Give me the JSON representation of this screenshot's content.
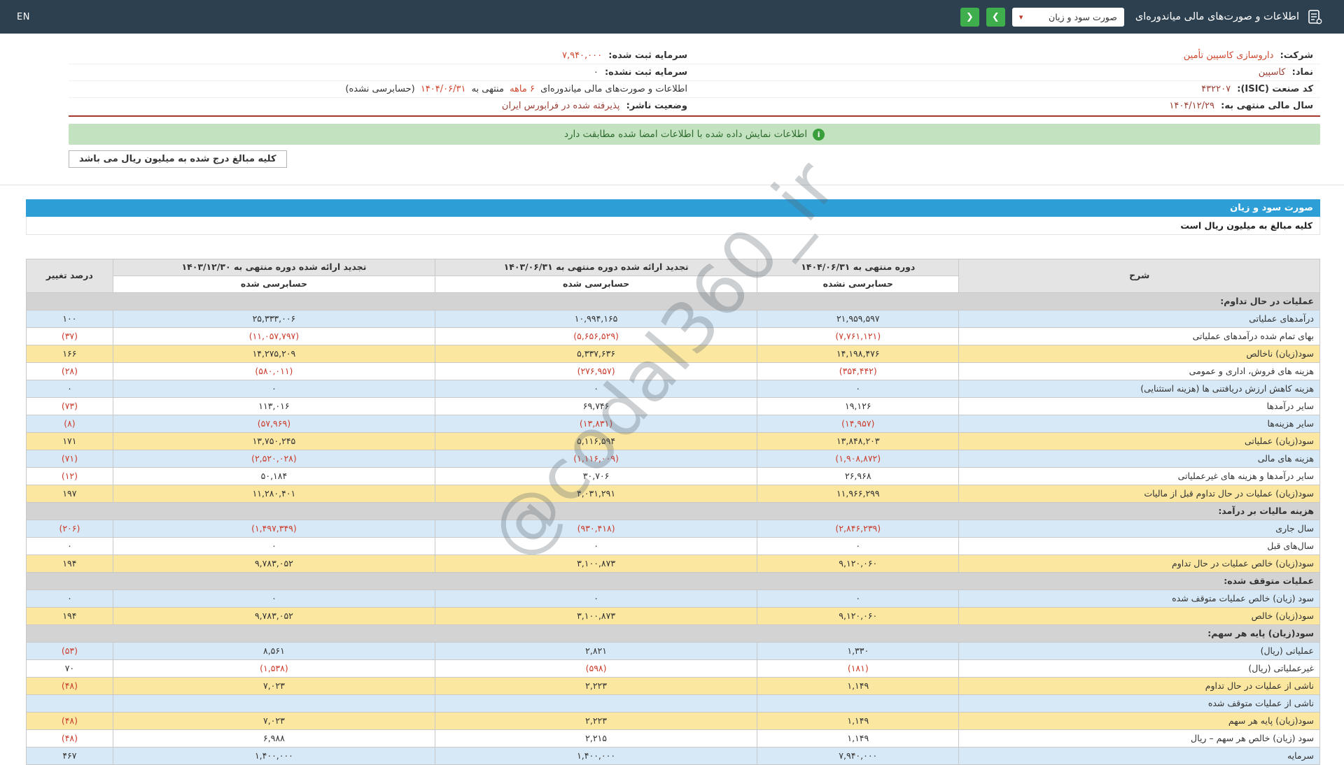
{
  "topbar": {
    "title": "اطلاعات و صورت‌های مالی میاندوره‌ای",
    "dropdown_value": "صورت سود و زیان",
    "dropdown_caret": "▾",
    "nav_forward": "❯",
    "nav_back": "❮",
    "lang": "EN"
  },
  "company_info": {
    "company": {
      "label": "شرکت:",
      "value": "داروسازی کاسپین تأمین"
    },
    "symbol": {
      "label": "نماد:",
      "value": "کاسپین"
    },
    "isic": {
      "label": "کد صنعت (ISIC):",
      "value": "۴۳۲۲۰۷"
    },
    "fiscal_year": {
      "label": "سال مالی منتهی به:",
      "value": "۱۴۰۴/۱۲/۲۹"
    },
    "capital_registered": {
      "label": "سرمایه ثبت شده:",
      "value": "۷,۹۴۰,۰۰۰"
    },
    "capital_unregistered": {
      "label": "سرمایه ثبت نشده:",
      "value": "۰"
    },
    "period_line": {
      "prefix": "اطلاعات و صورت‌های مالی میاندوره‌ای",
      "duration": "۶ ماهه",
      "middle": "منتهی به",
      "date": "۱۴۰۴/۰۶/۳۱",
      "suffix": "(حسابرسی نشده)"
    },
    "issuer_status": {
      "label": "وضعیت ناشر:",
      "value": "پذیرفته شده در فرابورس ایران"
    }
  },
  "notice": {
    "text": "اطلاعات نمایش داده شده با اطلاعات امضا شده مطابقت دارد",
    "icon_glyph": "i"
  },
  "amounts_note": "کلیه مبالغ درج شده به میلیون ریال می باشد",
  "statement": {
    "title": "صورت سود و زیان",
    "unit_note": "کلیه مبالغ به میلیون ریال است",
    "watermark": "@codal360_ir",
    "headers": {
      "desc": "شرح",
      "col1": "دوره منتهی به ۱۴۰۴/۰۶/۳۱",
      "col1_sub": "حسابرسی نشده",
      "col2": "تجدید ارائه شده دوره منتهی به ۱۴۰۳/۰۶/۳۱",
      "col2_sub": "حسابرسی شده",
      "col3": "تجدید ارائه شده دوره منتهی به ۱۴۰۳/۱۲/۳۰",
      "col3_sub": "حسابرسی شده",
      "change": "درصد تغییر"
    },
    "rows": [
      {
        "type": "section",
        "label": "عملیات در حال تداوم:"
      },
      {
        "type": "data",
        "bg": "blue",
        "label": "درآمدهای عملیاتی",
        "values": [
          "۲۱,۹۵۹,۵۹۷",
          "۱۰,۹۹۴,۱۶۵",
          "۲۵,۳۳۳,۰۰۶"
        ],
        "change": "۱۰۰"
      },
      {
        "type": "data",
        "bg": "white",
        "label": "بهای تمام شده درآمدهای عملیاتی",
        "values": [
          "(۷,۷۶۱,۱۲۱)",
          "(۵,۶۵۶,۵۲۹)",
          "(۱۱,۰۵۷,۷۹۷)"
        ],
        "change": "(۳۷)"
      },
      {
        "type": "data",
        "bg": "yellow",
        "label": "سود(زیان) ناخالص",
        "values": [
          "۱۴,۱۹۸,۴۷۶",
          "۵,۳۳۷,۶۳۶",
          "۱۴,۲۷۵,۲۰۹"
        ],
        "change": "۱۶۶"
      },
      {
        "type": "data",
        "bg": "white",
        "label": "هزینه های فروش، اداری و عمومی",
        "values": [
          "(۳۵۴,۴۴۲)",
          "(۲۷۶,۹۵۷)",
          "(۵۸۰,۰۱۱)"
        ],
        "change": "(۲۸)"
      },
      {
        "type": "data",
        "bg": "blue",
        "label": "هزینه کاهش ارزش دریافتنی ها (هزینه استثنایی)",
        "values": [
          "۰",
          "۰",
          "۰"
        ],
        "change": "۰"
      },
      {
        "type": "data",
        "bg": "white",
        "label": "سایر درآمدها",
        "values": [
          "۱۹,۱۲۶",
          "۶۹,۷۴۶",
          "۱۱۳,۰۱۶"
        ],
        "change": "(۷۳)"
      },
      {
        "type": "data",
        "bg": "blue",
        "label": "سایر هزینه‌ها",
        "values": [
          "(۱۴,۹۵۷)",
          "(۱۳,۸۳۱)",
          "(۵۷,۹۶۹)"
        ],
        "change": "(۸)"
      },
      {
        "type": "data",
        "bg": "yellow",
        "label": "سود(زیان) عملیاتی",
        "values": [
          "۱۳,۸۴۸,۲۰۳",
          "۵,۱۱۶,۵۹۴",
          "۱۳,۷۵۰,۲۴۵"
        ],
        "change": "۱۷۱"
      },
      {
        "type": "data",
        "bg": "blue",
        "label": "هزینه های مالی",
        "values": [
          "(۱,۹۰۸,۸۷۲)",
          "(۱,۱۱۶,۰۰۹)",
          "(۲,۵۲۰,۰۲۸)"
        ],
        "change": "(۷۱)"
      },
      {
        "type": "data",
        "bg": "white",
        "label": "سایر درآمدها و هزینه های غیرعملیاتی",
        "values": [
          "۲۶,۹۶۸",
          "۳۰,۷۰۶",
          "۵۰,۱۸۴"
        ],
        "change": "(۱۲)"
      },
      {
        "type": "data",
        "bg": "yellow",
        "label": "سود(زیان) عملیات در حال تداوم قبل از مالیات",
        "values": [
          "۱۱,۹۶۶,۲۹۹",
          "۴,۰۳۱,۲۹۱",
          "۱۱,۲۸۰,۴۰۱"
        ],
        "change": "۱۹۷"
      },
      {
        "type": "section",
        "label": "هزینه مالیات بر درآمد:"
      },
      {
        "type": "data",
        "bg": "blue",
        "label": "سال جاری",
        "values": [
          "(۲,۸۴۶,۲۳۹)",
          "(۹۳۰,۴۱۸)",
          "(۱,۴۹۷,۳۴۹)"
        ],
        "change": "(۲۰۶)"
      },
      {
        "type": "data",
        "bg": "white",
        "label": "سال‌های قبل",
        "values": [
          "۰",
          "۰",
          "۰"
        ],
        "change": "۰"
      },
      {
        "type": "data",
        "bg": "yellow",
        "label": "سود(زیان) خالص عملیات در حال تداوم",
        "values": [
          "۹,۱۲۰,۰۶۰",
          "۳,۱۰۰,۸۷۳",
          "۹,۷۸۳,۰۵۲"
        ],
        "change": "۱۹۴"
      },
      {
        "type": "section",
        "label": "عملیات متوقف شده:"
      },
      {
        "type": "data",
        "bg": "blue",
        "label": "سود (زیان) خالص عملیات متوقف شده",
        "values": [
          "۰",
          "۰",
          "۰"
        ],
        "change": "۰"
      },
      {
        "type": "data",
        "bg": "yellow",
        "label": "سود(زیان) خالص",
        "values": [
          "۹,۱۲۰,۰۶۰",
          "۳,۱۰۰,۸۷۳",
          "۹,۷۸۳,۰۵۲"
        ],
        "change": "۱۹۴"
      },
      {
        "type": "section",
        "label": "سود(زیان) پایه هر سهم:"
      },
      {
        "type": "data",
        "bg": "blue",
        "label": "عملیاتی (ریال)",
        "values": [
          "۱,۳۳۰",
          "۲,۸۲۱",
          "۸,۵۶۱"
        ],
        "change": "(۵۳)"
      },
      {
        "type": "data",
        "bg": "white",
        "label": "غیرعملیاتی (ریال)",
        "values": [
          "(۱۸۱)",
          "(۵۹۸)",
          "(۱,۵۳۸)"
        ],
        "change": "۷۰"
      },
      {
        "type": "data",
        "bg": "yellow",
        "label": "ناشی از عملیات در حال تداوم",
        "values": [
          "۱,۱۴۹",
          "۲,۲۲۳",
          "۷,۰۲۳"
        ],
        "change": "(۴۸)"
      },
      {
        "type": "data",
        "bg": "blue",
        "label": "ناشی از عملیات متوقف شده",
        "values": [
          "",
          "",
          ""
        ],
        "change": ""
      },
      {
        "type": "data",
        "bg": "yellow",
        "label": "سود(زیان) پایه هر سهم",
        "values": [
          "۱,۱۴۹",
          "۲,۲۲۳",
          "۷,۰۲۳"
        ],
        "change": "(۴۸)"
      },
      {
        "type": "data",
        "bg": "white",
        "label": "سود (زیان) خالص هر سهم – ریال",
        "values": [
          "۱,۱۴۹",
          "۲,۲۱۵",
          "۶,۹۸۸"
        ],
        "change": "(۴۸)"
      },
      {
        "type": "data",
        "bg": "blue",
        "label": "سرمایه",
        "values": [
          "۷,۹۴۰,۰۰۰",
          "۱,۴۰۰,۰۰۰",
          "۱,۴۰۰,۰۰۰"
        ],
        "change": "۴۶۷"
      }
    ]
  },
  "colors": {
    "topbar": "#2d4050",
    "accent_green": "#3fae4c",
    "accent_blue": "#2d9fd6",
    "negative_red": "#cb3d2e",
    "row_blue": "#d7e9f6",
    "row_yellow": "#fbe7a0",
    "section_gray": "#d3d3d3",
    "banner_green": "#c3e3c0"
  }
}
